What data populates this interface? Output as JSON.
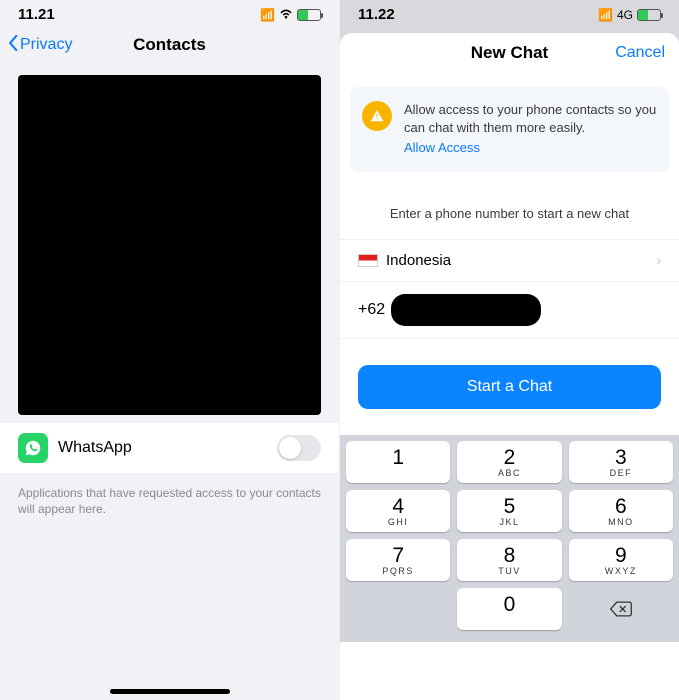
{
  "left": {
    "status": {
      "time": "11.21",
      "net": "",
      "wifi": true
    },
    "nav": {
      "back": "Privacy",
      "title": "Contacts"
    },
    "app": {
      "name": "WhatsApp"
    },
    "footer": "Applications that have requested access to your contacts will appear here."
  },
  "right": {
    "status": {
      "time": "11.22",
      "net": "4G"
    },
    "nav": {
      "title": "New Chat",
      "cancel": "Cancel"
    },
    "banner": {
      "text": "Allow access to your phone contacts so you can chat with them more easily.",
      "link": "Allow Access"
    },
    "hint": "Enter a phone number to start a new chat",
    "country": "Indonesia",
    "prefix": "+62",
    "button": "Start a Chat",
    "keypad": [
      {
        "n": "1",
        "s": ""
      },
      {
        "n": "2",
        "s": "ABC"
      },
      {
        "n": "3",
        "s": "DEF"
      },
      {
        "n": "4",
        "s": "GHI"
      },
      {
        "n": "5",
        "s": "JKL"
      },
      {
        "n": "6",
        "s": "MNO"
      },
      {
        "n": "7",
        "s": "PQRS"
      },
      {
        "n": "8",
        "s": "TUV"
      },
      {
        "n": "9",
        "s": "WXYZ"
      },
      {
        "n": "",
        "s": ""
      },
      {
        "n": "0",
        "s": ""
      },
      {
        "n": "⌫",
        "s": ""
      }
    ]
  }
}
